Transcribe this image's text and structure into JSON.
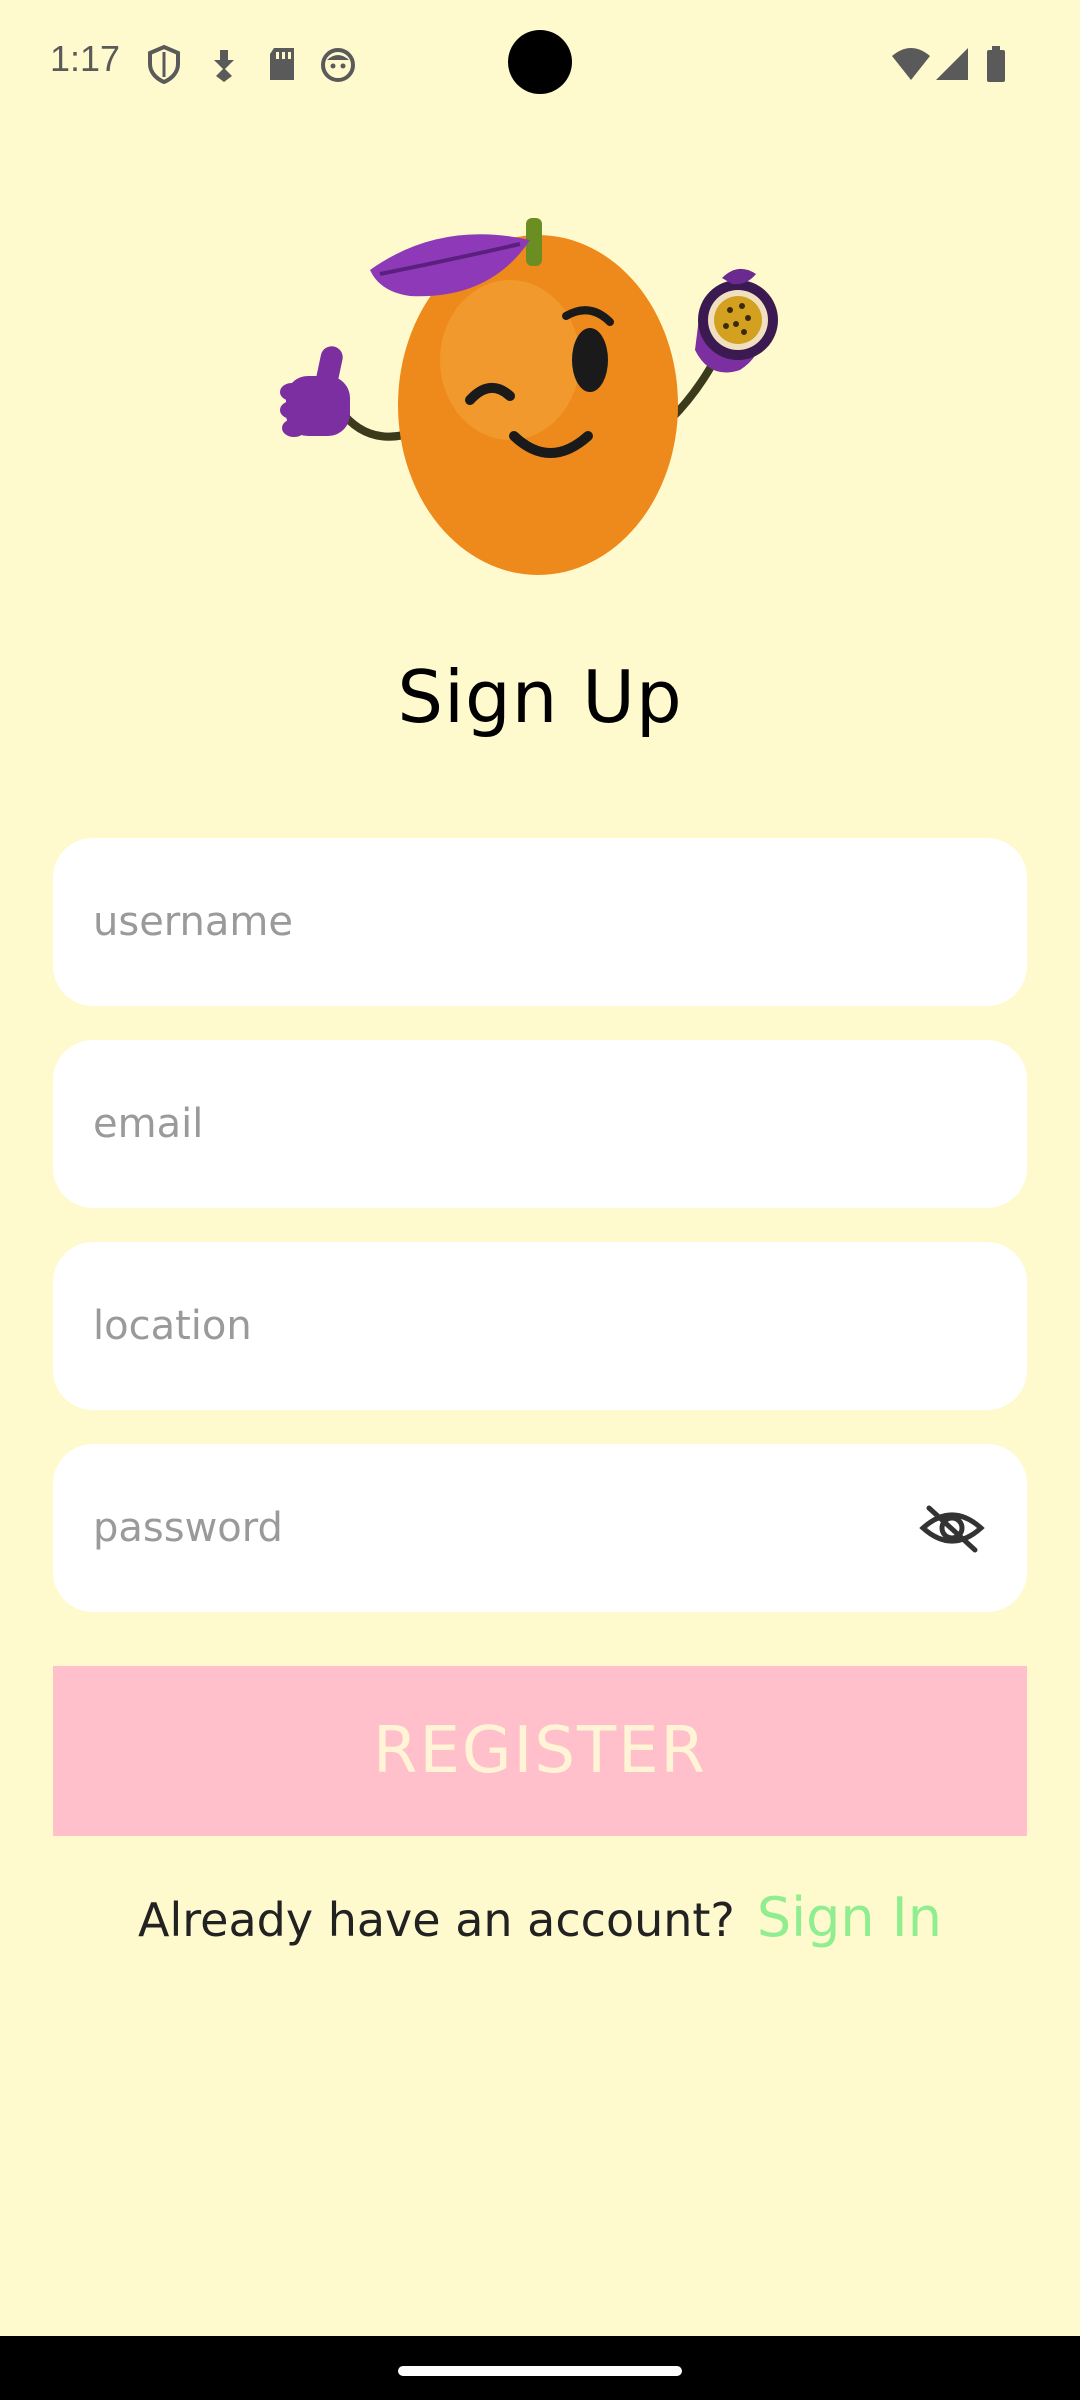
{
  "status_bar": {
    "time": "1:17",
    "left_icons": [
      "shield-icon",
      "download-badge-icon",
      "sd-card-icon",
      "face-icon"
    ],
    "right_icons": [
      "wifi-icon",
      "cell-signal-icon",
      "battery-icon"
    ]
  },
  "screen": {
    "title": "Sign Up",
    "background_color": "#FFFACD"
  },
  "form": {
    "username": {
      "placeholder": "username",
      "value": ""
    },
    "email": {
      "placeholder": "email",
      "value": ""
    },
    "location": {
      "placeholder": "location",
      "value": ""
    },
    "password": {
      "placeholder": "password",
      "value": "",
      "visibility_icon": "eye-off-icon"
    }
  },
  "register": {
    "label": "REGISTER",
    "color": "#FFC0CB"
  },
  "signin": {
    "prompt": "Already have an account?",
    "link": "Sign In",
    "link_color": "#90EE90"
  },
  "mascot": {
    "icon": "orange-mascot-icon"
  }
}
